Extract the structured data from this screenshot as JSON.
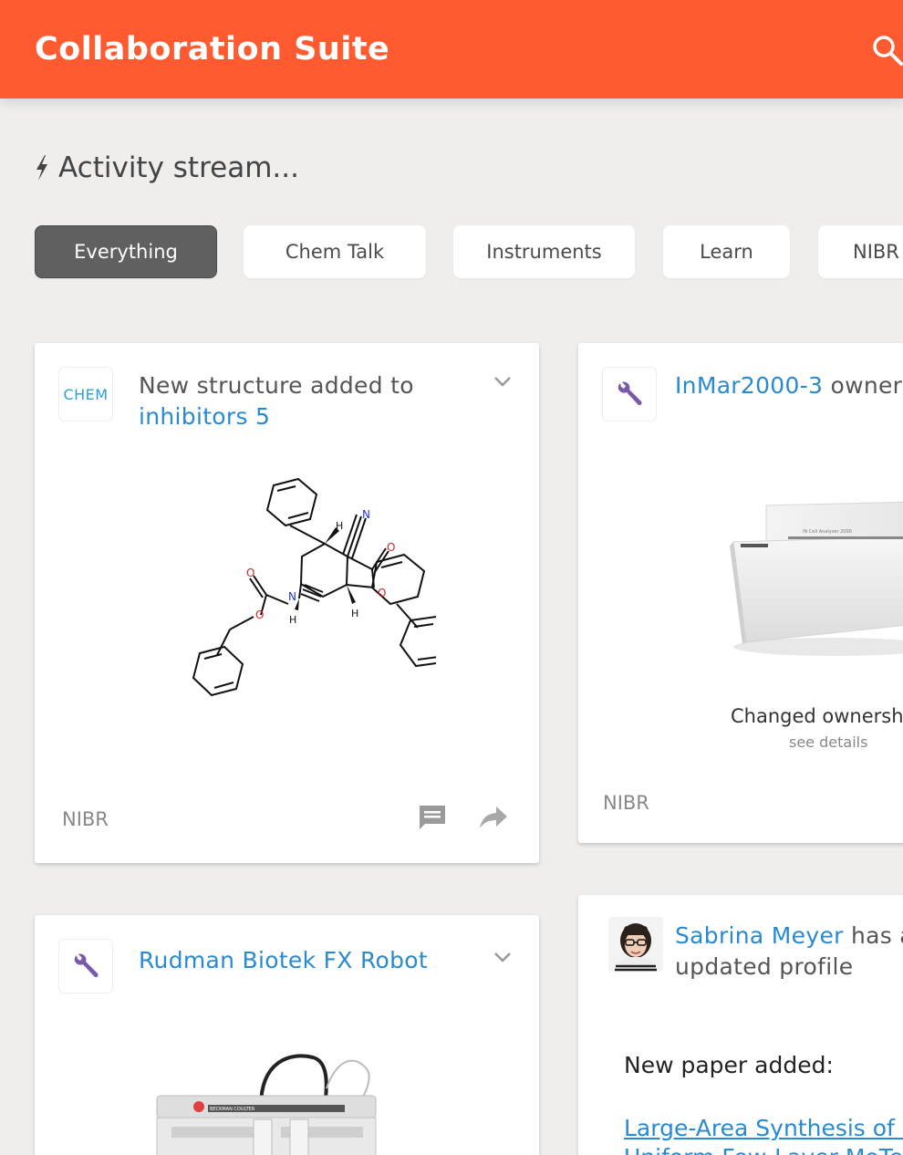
{
  "app": {
    "title": "Collaboration Suite"
  },
  "stream": {
    "title": "Activity stream..."
  },
  "filters": [
    "Everything",
    "Chem Talk",
    "Instruments",
    "Learn",
    "NIBR"
  ],
  "cards": {
    "structure": {
      "badge": "CHEM",
      "text_prefix": "New structure added to ",
      "link": "inhibitors 5",
      "atoms": {
        "n1": "N",
        "o1": "O",
        "o2": "O",
        "o3": "O",
        "o4": "O",
        "n2": "N",
        "h1": "H",
        "h2": "H",
        "h3": "H"
      },
      "source": "NIBR"
    },
    "instrument": {
      "link": "InMar2000-3",
      "text_suffix": " owner change",
      "device_label": "IN Cell Analyzer 2000",
      "caption": "Changed ownersh",
      "subcaption": "see details",
      "source": "NIBR"
    },
    "robot": {
      "link": "Rudman Biotek FX Robot",
      "brand": "BECKMAN COULTER"
    },
    "profile": {
      "link": "Sabrina Meyer",
      "text_suffix": " has a",
      "text_line2": "updated profile",
      "paper_head": "New paper added:",
      "paper_link_1": "Large-Area Synthesis of H",
      "paper_link_2": "Uniform Few-Layer MoTe"
    }
  },
  "colors": {
    "brand": "#ff5a30",
    "link": "#2a8ad0",
    "icon_purple": "#7a5aa8",
    "active_chip": "#606060"
  }
}
